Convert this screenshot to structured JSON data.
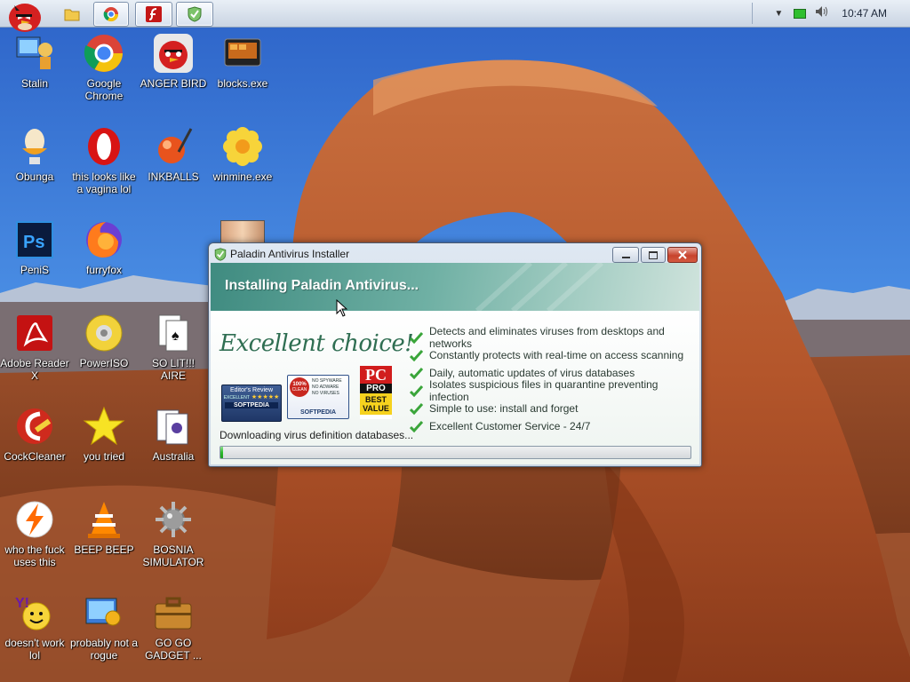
{
  "taskbar": {
    "clock": "10:47 AM",
    "buttons": [
      "explorer",
      "chrome",
      "flash",
      "paladin-antivirus"
    ]
  },
  "desktop": {
    "icons": [
      {
        "label": "Stalin",
        "icon": "monitor-user-icon"
      },
      {
        "label": "Google Chrome",
        "icon": "chrome-icon"
      },
      {
        "label": "ANGER BIRD",
        "icon": "angry-bird-icon"
      },
      {
        "label": "blocks.exe",
        "icon": "blocks-game-icon"
      },
      {
        "label": "Obunga",
        "icon": "egg-cup-icon"
      },
      {
        "label": "this looks like a vagina lol",
        "icon": "opera-icon"
      },
      {
        "label": "INKBALLS",
        "icon": "inkball-icon"
      },
      {
        "label": "winmine.exe",
        "icon": "flower-icon"
      },
      {
        "label": "PeniS",
        "icon": "photoshop-icon"
      },
      {
        "label": "furryfox",
        "icon": "firefox-icon"
      },
      {
        "label": "Adobe Reader X",
        "icon": "adobe-reader-icon"
      },
      {
        "label": "PowerISO",
        "icon": "disc-icon"
      },
      {
        "label": "SO LIT!!! AIRE",
        "icon": "cards-icon"
      },
      {
        "label": "CockCleaner",
        "icon": "ccleaner-icon"
      },
      {
        "label": "you tried",
        "icon": "star-icon"
      },
      {
        "label": "Australia",
        "icon": "spider-solitaire-icon"
      },
      {
        "label": "who the fuck uses this",
        "icon": "lightning-icon"
      },
      {
        "label": "BEEP BEEP",
        "icon": "vlc-cone-icon"
      },
      {
        "label": "BOSNIA SIMULATOR",
        "icon": "mine-icon"
      },
      {
        "label": "doesn't work lol",
        "icon": "yahoo-messenger-icon"
      },
      {
        "label": "probably not a rogue",
        "icon": "control-panel-icon"
      },
      {
        "label": "GO GO GADGET ...",
        "icon": "briefcase-icon"
      }
    ]
  },
  "installer": {
    "window_title": "Paladin Antivirus Installer",
    "header": "Installing Paladin Antivirus...",
    "tagline": "Excellent choice!",
    "features": [
      "Detects and eliminates viruses from desktops and networks",
      "Constantly protects with real-time on access scanning",
      "Daily, automatic updates of virus databases",
      "Isolates suspicious files in quarantine preventing infection",
      "Simple to use: install and forget",
      "Excellent Customer Service - 24/7"
    ],
    "status": "Downloading virus definition databases...",
    "progress": 0.005,
    "badges": {
      "softpedia_review_title": "Editor's Review",
      "softpedia_review_sub": "EXCELLENT",
      "softpedia_name": "SOFTPEDIA",
      "clean_pct": "100%",
      "clean_word": "CLEAN",
      "no_spyware": "NO SPYWARE",
      "no_adware": "NO ADWARE",
      "no_viruses": "NO VIRUSES",
      "pc_logo": "PC",
      "pro_logo": "PRO",
      "best_value": "BEST VALUE"
    }
  },
  "colors": {
    "accent_teal": "#3f8b80",
    "tagline_green": "#2f6e52",
    "progress_green": "#2dbb2d"
  }
}
